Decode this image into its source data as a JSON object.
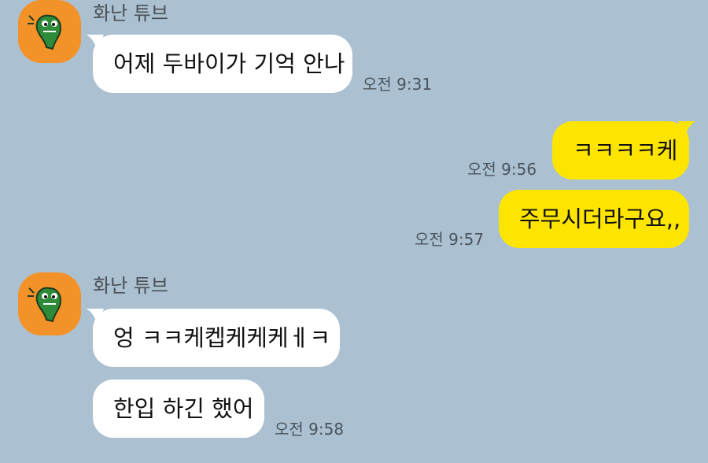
{
  "colors": {
    "background": "#abc1d1",
    "incoming_bubble": "#ffffff",
    "outgoing_bubble": "#fee500",
    "avatar": "#f4922a"
  },
  "messages": [
    {
      "sender": "화난 튜브",
      "text": "어제 두바이가 기억 안나",
      "time": "오전 9:31",
      "direction": "incoming"
    },
    {
      "text": "ㅋㅋㅋㅋ케",
      "time": "오전 9:56",
      "direction": "outgoing"
    },
    {
      "text": "주무시더라구요,,",
      "time": "오전 9:57",
      "direction": "outgoing"
    },
    {
      "sender": "화난 튜브",
      "text": "엉 ㅋㅋ케켑케케케ㅔㅋ",
      "direction": "incoming"
    },
    {
      "text": "한입 하긴 했어",
      "time": "오전 9:58",
      "direction": "incoming"
    }
  ],
  "icons": {
    "avatar": "angry-tube-crocodile-avatar-icon"
  }
}
